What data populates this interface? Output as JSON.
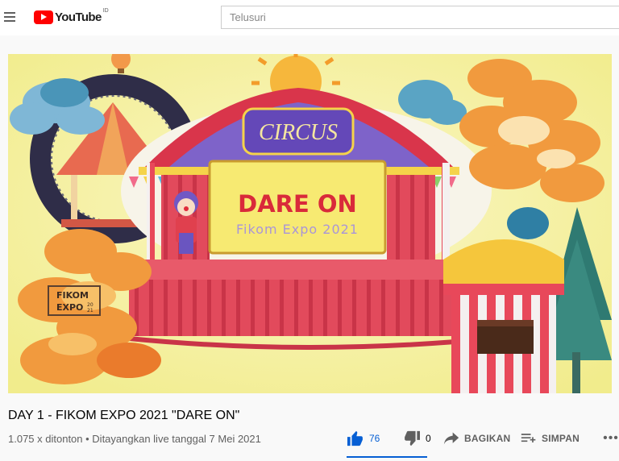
{
  "header": {
    "logo_text": "YouTube",
    "logo_region": "ID",
    "search_placeholder": "Telusuri"
  },
  "video": {
    "thumbnail": {
      "sign_title": "DARE ON",
      "sign_subtitle": "Fikom Expo 2021",
      "tent_banner": "CIRCUS",
      "corner_logo_line1": "FIKOM",
      "corner_logo_line2": "EXPO",
      "corner_logo_year_top": "20",
      "corner_logo_year_bottom": "21"
    },
    "title": "DAY 1 - FIKOM EXPO 2021 \"DARE ON\"",
    "meta": "1.075 x ditonton • Ditayangkan live tanggal 7 Mei 2021"
  },
  "actions": {
    "like_count": "76",
    "dislike_count": "0",
    "share_label": "BAGIKAN",
    "save_label": "SIMPAN",
    "more_label": "•••",
    "like_ratio": 1.0
  },
  "colors": {
    "brand_red": "#ff0000",
    "accent_blue": "#065fd4"
  }
}
